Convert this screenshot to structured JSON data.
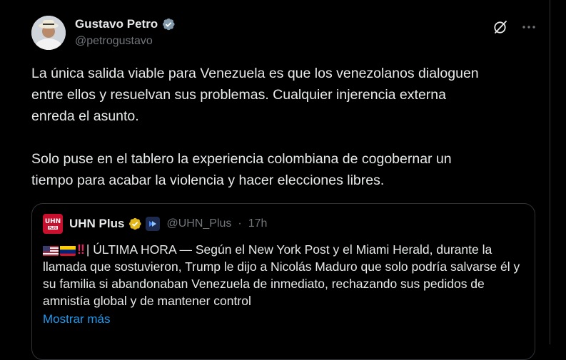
{
  "author": {
    "display_name": "Gustavo Petro",
    "handle": "@petrogustavo",
    "verified_icon": "verified-badge-icon",
    "avatar_icon": "profile-avatar"
  },
  "actions": {
    "grok_icon": "grok-icon",
    "more_icon": "more-options-icon"
  },
  "tweet": {
    "text": "La única salida viable para Venezuela es que los venezolanos dialoguen\nentre ellos y resuelvan sus problemas. Cualquier injerencia externa\nenreda el asunto.\n\nSolo puse en el tablero la experiencia colombiana de cogobernar un\ntiempo para acabar la violencia y hacer elecciones libres."
  },
  "quote": {
    "avatar_text": "UHN",
    "avatar_sub": "PLUS",
    "display_name": "UHN Plus",
    "handle": "@UHN_Plus",
    "separator": "·",
    "time": "17h",
    "emoji": "‼",
    "text": "| ÚLTIMA HORA — Según el New York Post y el Miami Herald, durante la llamada que sostuvieron, Trump le dijo a Nicolás Maduro que solo podría salvarse él y su familia si abandonaban Venezuela de inmediato, rechazando sus pedidos de amnistía global y de mantener control",
    "show_more": "Mostrar más"
  },
  "colors": {
    "background": "#000000",
    "text": "#e7e9ea",
    "secondary": "#71767b",
    "link": "#1d9bf0",
    "border": "#2f3336",
    "gold_badge": "#e2b719"
  }
}
